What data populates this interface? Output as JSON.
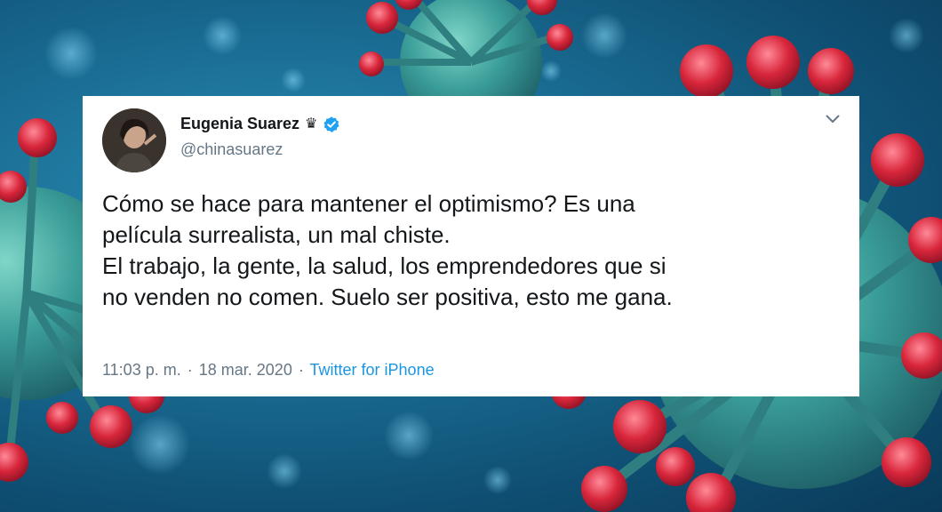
{
  "tweet": {
    "display_name": "Eugenia Suarez",
    "crown_glyph": "♛",
    "handle": "@chinasuarez",
    "lines": [
      "Cómo se hace para mantener el optimismo? Es una",
      "película surrealista, un mal chiste.",
      "El trabajo, la gente, la salud, los emprendedores que si",
      "no venden no comen. Suelo ser positiva, esto me gana."
    ],
    "time": "11:03 p. m.",
    "separator": "·",
    "date": "18 mar. 2020",
    "source": "Twitter for iPhone"
  },
  "icons": {
    "verified": "verified-badge-icon",
    "menu": "chevron-down-icon",
    "crown": "crown-icon"
  },
  "colors": {
    "link": "#1b95e0",
    "verified": "#1da1f2",
    "secondary_text": "#657786",
    "primary_text": "#14171a",
    "virus_body": "#3fa7a3",
    "virus_spike": "#d8263b"
  }
}
